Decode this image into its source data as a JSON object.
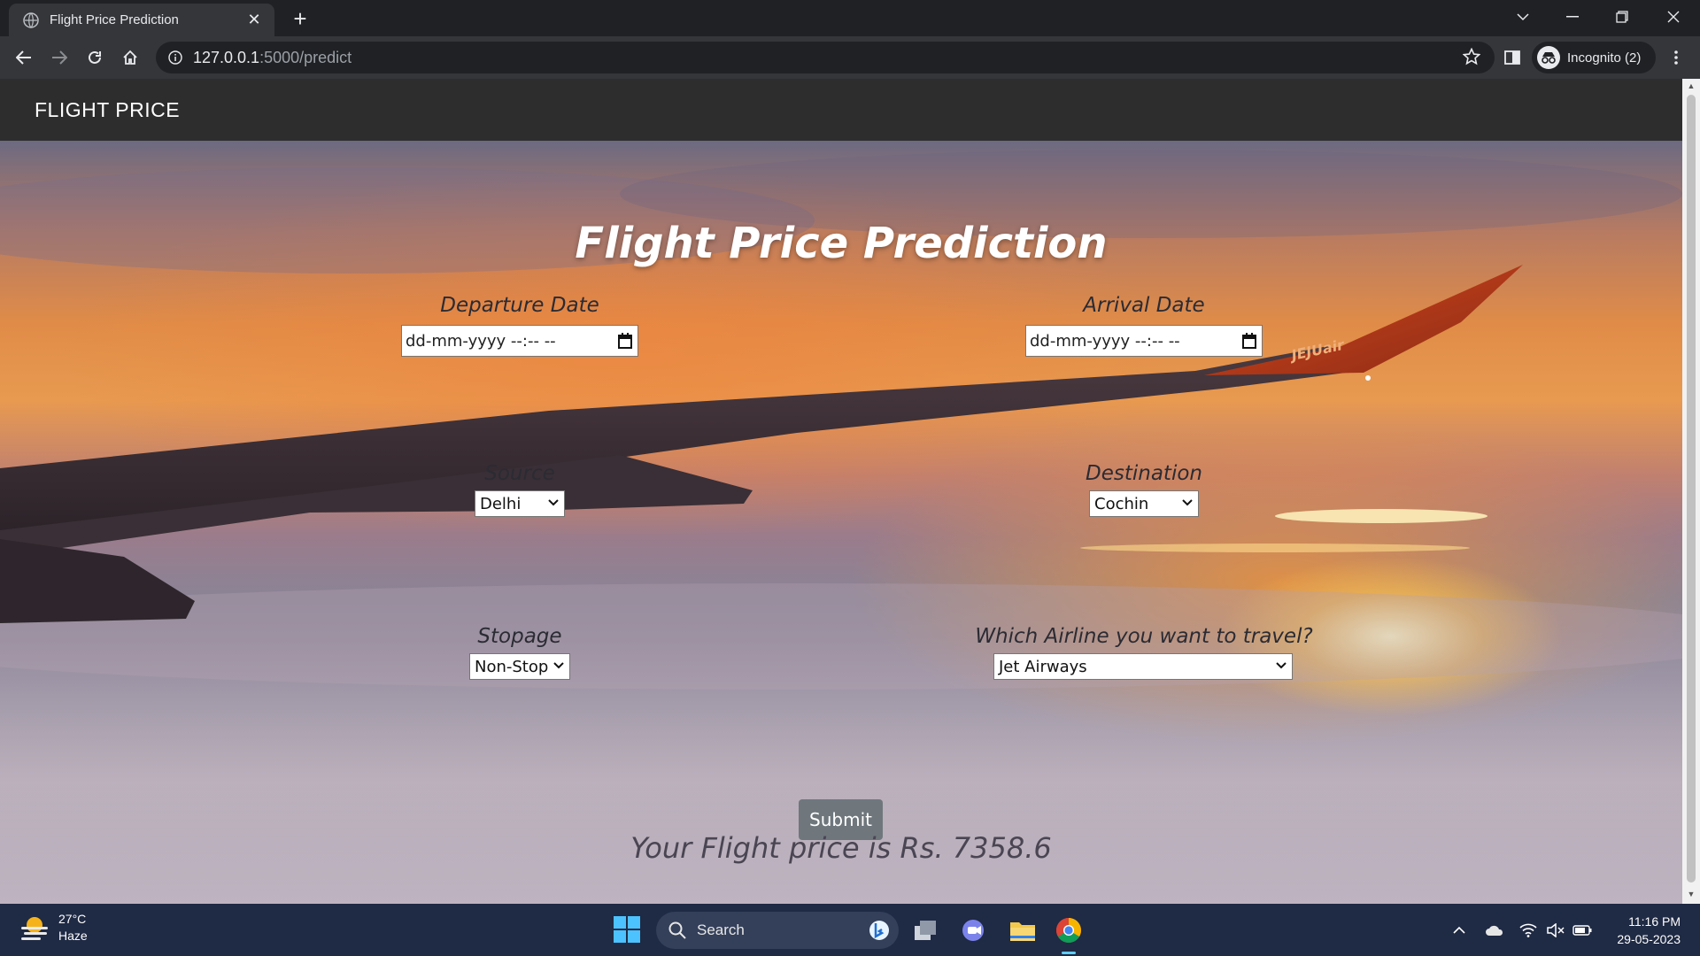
{
  "browser": {
    "tab_title": "Flight Price Prediction",
    "tab_close": "✕",
    "new_tab": "+",
    "url_host": "127.0.0.1",
    "url_path": ":5000/predict",
    "incognito_label": "Incognito (2)"
  },
  "site": {
    "brand": "FLIGHT PRICE",
    "title": "Flight Price Prediction",
    "departure": {
      "label": "Departure Date",
      "placeholder": "dd-mm-yyyy --:-- --"
    },
    "arrival": {
      "label": "Arrival Date",
      "placeholder": "dd-mm-yyyy --:-- --"
    },
    "source": {
      "label": "Source",
      "value": "Delhi"
    },
    "destination": {
      "label": "Destination",
      "value": "Cochin"
    },
    "stopage": {
      "label": "Stopage",
      "value": "Non-Stop"
    },
    "airline": {
      "label": "Which Airline you want to travel?",
      "value": "Jet Airways"
    },
    "submit_label": "Submit",
    "result": "Your Flight price is Rs. 7358.6",
    "wing_text": "JEJUair"
  },
  "taskbar": {
    "temperature": "27°C",
    "weather": "Haze",
    "search_label": "Search",
    "time": "11:16 PM",
    "date": "29-05-2023"
  },
  "colors": {
    "chrome_dark": "#202124",
    "chrome_toolbar": "#35363a",
    "navbar": "#2d2d2d",
    "submit": "#6f777d",
    "taskbar": "#1f2a44"
  }
}
